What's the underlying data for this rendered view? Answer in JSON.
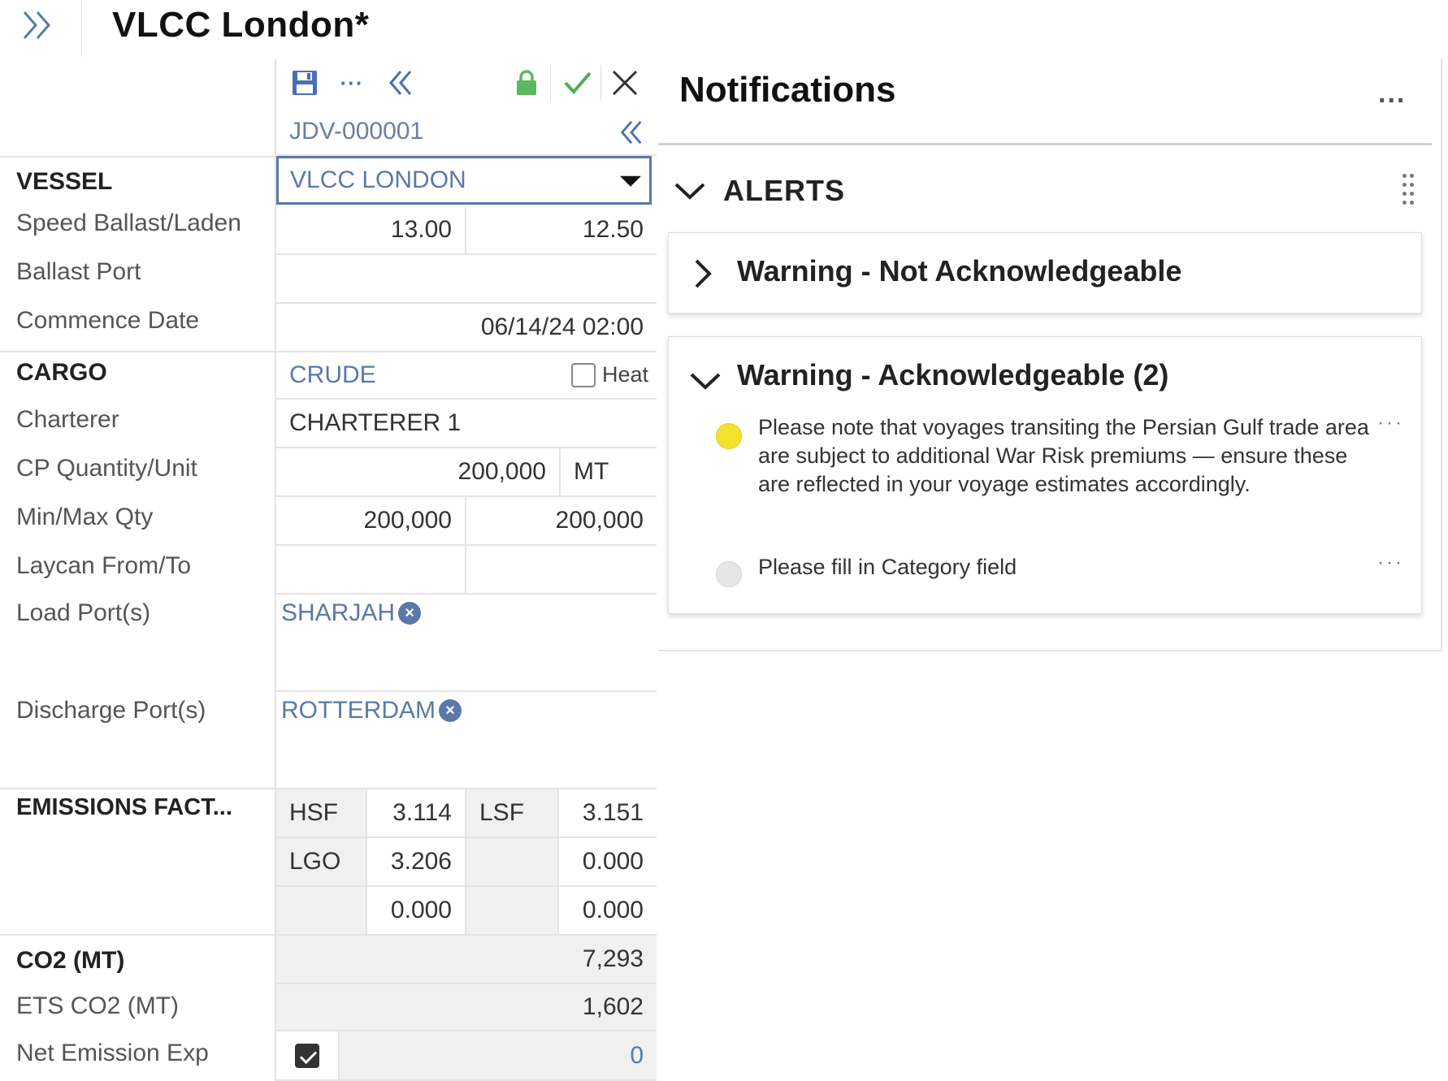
{
  "header": {
    "title": "VLCC London*"
  },
  "toolbar": {
    "record_id": "JDV-000001"
  },
  "form": {
    "vessel": {
      "label": "VESSEL",
      "value": "VLCC LONDON"
    },
    "speed": {
      "label": "Speed Ballast/Laden",
      "ballast": "13.00",
      "laden": "12.50"
    },
    "ballast_port": {
      "label": "Ballast Port",
      "value": ""
    },
    "commence_date": {
      "label": "Commence Date",
      "value": "06/14/24 02:00"
    },
    "cargo": {
      "label": "CARGO",
      "value": "CRUDE",
      "heat_label": "Heat",
      "heat_checked": false
    },
    "charterer": {
      "label": "Charterer",
      "value": "CHARTERER 1"
    },
    "cp_qty": {
      "label": "CP Quantity/Unit",
      "qty": "200,000",
      "unit": "MT"
    },
    "min_max": {
      "label": "Min/Max Qty",
      "min": "200,000",
      "max": "200,000"
    },
    "laycan": {
      "label": "Laycan From/To",
      "from": "",
      "to": ""
    },
    "load_ports": {
      "label": "Load Port(s)",
      "chips": [
        "SHARJAH"
      ]
    },
    "discharge_ports": {
      "label": "Discharge Port(s)",
      "chips": [
        "ROTTERDAM"
      ]
    },
    "emissions": {
      "label": "EMISSIONS FACT...",
      "r1": {
        "a_name": "HSF",
        "a_val": "3.114",
        "b_name": "LSF",
        "b_val": "3.151"
      },
      "r2": {
        "a_name": "LGO",
        "a_val": "3.206",
        "b_name": "",
        "b_val": "0.000"
      },
      "r3": {
        "a_name": "",
        "a_val": "0.000",
        "b_name": "",
        "b_val": "0.000"
      }
    },
    "co2": {
      "label": "CO2 (MT)",
      "value": "7,293"
    },
    "ets_co2": {
      "label": "ETS CO2 (MT)",
      "value": "1,602"
    },
    "net_emission": {
      "label": "Net Emission Exp",
      "checked": true,
      "value": "0"
    }
  },
  "notifications": {
    "title": "Notifications",
    "more_label": "...",
    "alerts_label": "ALERTS",
    "not_ack": {
      "title": "Warning - Not Acknowledgeable"
    },
    "ack": {
      "title": "Warning - Acknowledgeable (2)",
      "items": [
        {
          "text": "Please note that voyages transiting the Persian Gulf trade area are subject to additional War Risk premiums — ensure these are reflected in your voyage estimates accordingly.",
          "status_color": "#f2e22c"
        },
        {
          "text": "Please fill in Category field",
          "status_color": "#e6e6e6"
        }
      ]
    }
  },
  "colors": {
    "accent": "#5a79a8",
    "lock_green": "#5cb85c",
    "check_green": "#4caf50"
  }
}
